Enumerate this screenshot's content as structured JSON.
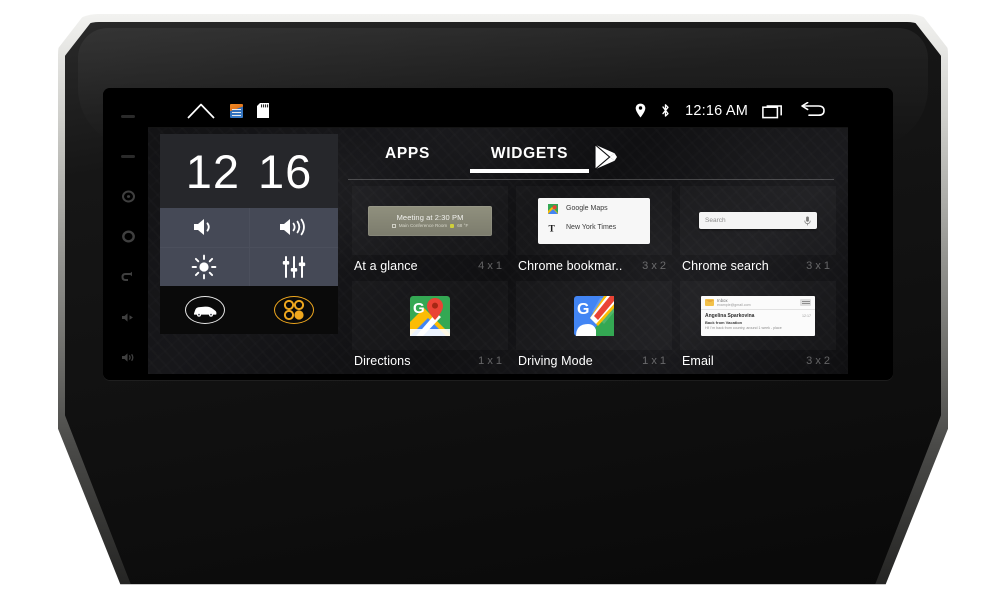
{
  "device": {
    "name": "car-head-unit",
    "accent_orange": "#f0a81e",
    "panel_gray": "#454956",
    "screen_bg": "#0d0d0f"
  },
  "status_bar": {
    "home_icon": "home-icon",
    "app_icon": "app-notification-icon",
    "sd_icon": "sd-card-icon",
    "location_icon": "location-pin-icon",
    "bluetooth_icon": "bluetooth-icon",
    "clock": "12:16 AM",
    "recents_icon": "recents-icon",
    "back_icon": "back-icon"
  },
  "launcher": {
    "tabs": [
      {
        "label": "APPS",
        "active": false
      },
      {
        "label": "WIDGETS",
        "active": true
      }
    ],
    "play_store_icon": "play-store-icon",
    "widgets": [
      {
        "name": "At a glance",
        "size": "4 x 1",
        "preview": {
          "type": "glance",
          "title": "Meeting at 2:30 PM",
          "subtitle": "Main Conference Room",
          "temp": "68 °F"
        }
      },
      {
        "name": "Chrome bookmar..",
        "size": "3 x 2",
        "preview": {
          "type": "bookmarks",
          "items": [
            "Google Maps",
            "New York Times"
          ]
        }
      },
      {
        "name": "Chrome search",
        "size": "3 x 1",
        "preview": {
          "type": "searchbar",
          "placeholder": "Search",
          "mic_icon": "microphone-icon"
        }
      },
      {
        "name": "Directions",
        "size": "1 x 1",
        "preview": {
          "type": "appicon",
          "icon": "google-maps-icon"
        }
      },
      {
        "name": "Driving Mode",
        "size": "1 x 1",
        "preview": {
          "type": "appicon",
          "icon": "google-maps-driving-icon"
        }
      },
      {
        "name": "Email",
        "size": "3 x 2",
        "preview": {
          "type": "email",
          "account_label": "Inbox",
          "account_address": "example@gmail.com",
          "sender": "Angelina Sparkovina",
          "time": "12:17",
          "subject": "Back from Vacation",
          "snippet": "Hi! I'm back from country, around 1 week - place"
        }
      }
    ]
  },
  "control_panel": {
    "clock_hours": "12",
    "clock_minutes": "16",
    "buttons": [
      {
        "name": "volume-down-button",
        "icon": "volume-low-icon"
      },
      {
        "name": "volume-up-button",
        "icon": "volume-high-icon"
      },
      {
        "name": "brightness-button",
        "icon": "brightness-icon"
      },
      {
        "name": "equalizer-button",
        "icon": "equalizer-icon"
      }
    ],
    "bottom": [
      {
        "name": "car-button",
        "icon": "car-icon"
      },
      {
        "name": "apps-button",
        "icon": "apps-grid-icon"
      }
    ]
  },
  "side_buttons": [
    {
      "name": "side-dash-1",
      "icon": "dash-icon"
    },
    {
      "name": "side-dash-2",
      "icon": "dash-icon"
    },
    {
      "name": "power-button",
      "icon": "power-icon"
    },
    {
      "name": "home-hard-button",
      "icon": "circle-icon"
    },
    {
      "name": "back-hard-button",
      "icon": "back-arrow-icon"
    },
    {
      "name": "volume-down-hard-button",
      "icon": "volume-down-icon"
    },
    {
      "name": "volume-up-hard-button",
      "icon": "volume-up-icon"
    }
  ]
}
